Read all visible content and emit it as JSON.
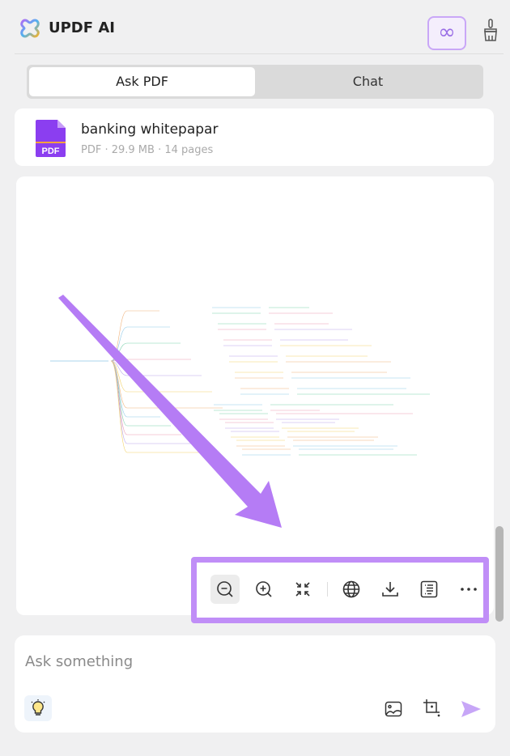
{
  "header": {
    "title": "UPDF AI",
    "infinity_icon": "infinity-icon",
    "clear_icon": "broom-icon"
  },
  "tabs": [
    {
      "label": "Ask PDF",
      "active": true
    },
    {
      "label": "Chat",
      "active": false
    }
  ],
  "file": {
    "name": "banking whitepapar",
    "meta": "PDF · 29.9 MB · 14 pages",
    "icon_label": "PDF"
  },
  "toolbar": {
    "items": [
      "zoom-out-icon",
      "zoom-in-icon",
      "collapse-icon",
      "globe-icon",
      "download-icon",
      "outline-icon",
      "more-icon"
    ],
    "highlight_color": "#c08ef7"
  },
  "input": {
    "placeholder": "Ask something"
  },
  "colors": {
    "accent": "#9a6ee6",
    "arrow": "#b57cf5",
    "send": "#c7a6f7"
  }
}
